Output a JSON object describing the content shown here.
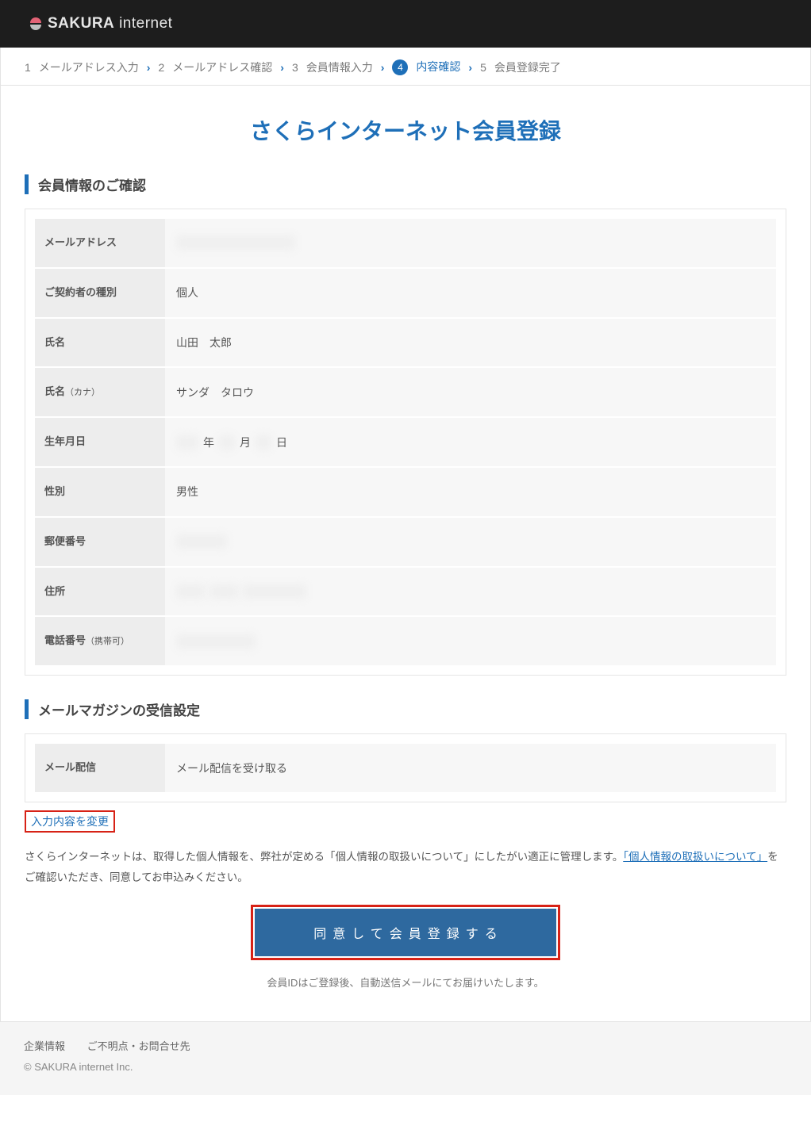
{
  "brand": {
    "name_strong": "SAKURA",
    "name_light": "internet"
  },
  "steps": [
    {
      "num": "1",
      "label": "メールアドレス入力",
      "active": false
    },
    {
      "num": "2",
      "label": "メールアドレス確認",
      "active": false
    },
    {
      "num": "3",
      "label": "会員情報入力",
      "active": false
    },
    {
      "num": "4",
      "label": "内容確認",
      "active": true
    },
    {
      "num": "5",
      "label": "会員登録完了",
      "active": false
    }
  ],
  "page_title": "さくらインターネット会員登録",
  "section_info_title": "会員情報のご確認",
  "info_rows": {
    "email": {
      "label": "メールアドレス",
      "value": ""
    },
    "type": {
      "label": "ご契約者の種別",
      "value": "個人"
    },
    "name": {
      "label": "氏名",
      "value": "山田　太郎"
    },
    "name_kana": {
      "label": "氏名",
      "sub": "（カナ）",
      "value": "サンダ　タロウ"
    },
    "birth": {
      "label": "生年月日",
      "year_suffix": "年",
      "month_suffix": "月",
      "day_suffix": "日"
    },
    "gender": {
      "label": "性別",
      "value": "男性"
    },
    "postal": {
      "label": "郵便番号",
      "value": ""
    },
    "address": {
      "label": "住所",
      "value": ""
    },
    "phone": {
      "label": "電話番号",
      "sub": "（携帯可）",
      "value": ""
    }
  },
  "section_mail_title": "メールマガジンの受信設定",
  "mail_row": {
    "label": "メール配信",
    "value": "メール配信を受け取る"
  },
  "edit_link": "入力内容を変更",
  "consent": {
    "pre": "さくらインターネットは、取得した個人情報を、弊社が定める「個人情報の取扱いについて」にしたがい適正に管理します。",
    "link": "「個人情報の取扱いについて」",
    "post": "をご確認いただき、同意してお申込みください。"
  },
  "submit_label": "同意して会員登録する",
  "submit_note": "会員IDはご登録後、自動送信メールにてお届けいたします。",
  "footer": {
    "link1": "企業情報",
    "link2": "ご不明点・お問合せ先",
    "copyright": "© SAKURA internet Inc."
  }
}
